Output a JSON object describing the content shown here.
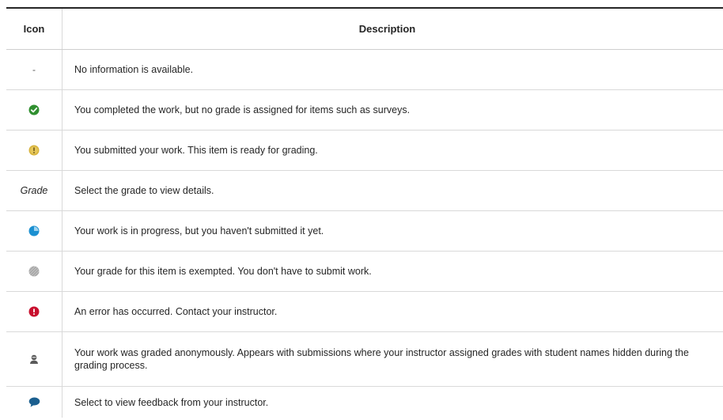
{
  "header": {
    "icon": "Icon",
    "description": "Description"
  },
  "rows": [
    {
      "icon_text": "-",
      "icon_name": "none",
      "description": "No information is available."
    },
    {
      "icon_name": "check-circle-icon",
      "color": "#2f8f2f",
      "description": "You completed the work, but no grade is assigned for items such as surveys."
    },
    {
      "icon_name": "exclamation-circle-yellow-icon",
      "color": "#d7b33b",
      "description": "You submitted your work. This item is ready for grading."
    },
    {
      "icon_text": "Grade",
      "icon_name": "none",
      "description": "Select the grade to view details."
    },
    {
      "icon_name": "in-progress-pie-icon",
      "color": "#1b90d1",
      "description": "Your work is in progress, but you haven't submitted it yet."
    },
    {
      "icon_name": "exempt-hatched-circle-icon",
      "color": "#9a9a9a",
      "description": "Your grade for this item is exempted. You don't have to submit work."
    },
    {
      "icon_name": "error-circle-red-icon",
      "color": "#c8102e",
      "description": "An error has occurred. Contact your instructor."
    },
    {
      "icon_name": "anonymous-user-icon",
      "color": "#5a5a5a",
      "description": "Your work was graded anonymously. Appears with submissions where your instructor assigned grades with student names hidden during the grading process."
    },
    {
      "icon_name": "feedback-speech-bubble-icon",
      "color": "#1b5f8f",
      "description": "Select to view feedback from your instructor."
    }
  ]
}
